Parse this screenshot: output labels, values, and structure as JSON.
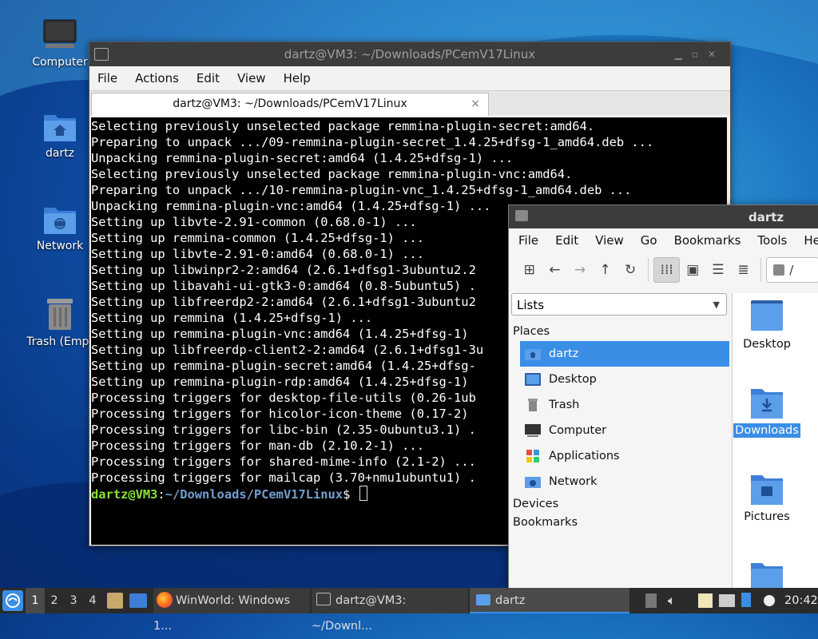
{
  "desktop": {
    "icons": [
      {
        "label": "Computer",
        "icon": "computer-icon"
      },
      {
        "label": "dartz",
        "icon": "home-folder-icon"
      },
      {
        "label": "Network",
        "icon": "network-folder-icon"
      },
      {
        "label": "Trash (Empt",
        "icon": "trash-icon"
      }
    ]
  },
  "terminal": {
    "window_title": "dartz@VM3: ~/Downloads/PCemV17Linux",
    "menu": [
      "File",
      "Actions",
      "Edit",
      "View",
      "Help"
    ],
    "tab_label": "dartz@VM3: ~/Downloads/PCemV17Linux",
    "tab_close": "×",
    "lines": [
      "Selecting previously unselected package remmina-plugin-secret:amd64.",
      "Preparing to unpack .../09-remmina-plugin-secret_1.4.25+dfsg-1_amd64.deb ...",
      "Unpacking remmina-plugin-secret:amd64 (1.4.25+dfsg-1) ...",
      "Selecting previously unselected package remmina-plugin-vnc:amd64.",
      "Preparing to unpack .../10-remmina-plugin-vnc_1.4.25+dfsg-1_amd64.deb ...",
      "Unpacking remmina-plugin-vnc:amd64 (1.4.25+dfsg-1) ...",
      "Setting up libvte-2.91-common (0.68.0-1) ...",
      "Setting up remmina-common (1.4.25+dfsg-1) ...",
      "Setting up libvte-2.91-0:amd64 (0.68.0-1) ...",
      "Setting up libwinpr2-2:amd64 (2.6.1+dfsg1-3ubuntu2.2",
      "Setting up libavahi-ui-gtk3-0:amd64 (0.8-5ubuntu5) .",
      "Setting up libfreerdp2-2:amd64 (2.6.1+dfsg1-3ubuntu2",
      "Setting up remmina (1.4.25+dfsg-1) ...",
      "Setting up remmina-plugin-vnc:amd64 (1.4.25+dfsg-1)",
      "Setting up libfreerdp-client2-2:amd64 (2.6.1+dfsg1-3u",
      "Setting up remmina-plugin-secret:amd64 (1.4.25+dfsg-",
      "Setting up remmina-plugin-rdp:amd64 (1.4.25+dfsg-1)",
      "Processing triggers for desktop-file-utils (0.26-1ub",
      "Processing triggers for hicolor-icon-theme (0.17-2)",
      "Processing triggers for libc-bin (2.35-0ubuntu3.1) .",
      "Processing triggers for man-db (2.10.2-1) ...",
      "Processing triggers for shared-mime-info (2.1-2) ...",
      "Processing triggers for mailcap (3.70+nmu1ubuntu1) ."
    ],
    "prompt_user": "dartz@VM3",
    "prompt_sep": ":",
    "prompt_path": "~/Downloads/PCemV17Linux",
    "prompt_end": "$ "
  },
  "filemanager": {
    "window_title": "dartz",
    "menu": [
      "File",
      "Edit",
      "View",
      "Go",
      "Bookmarks",
      "Tools",
      "Help"
    ],
    "path_text": "/",
    "side_combo": "Lists",
    "places_header": "Places",
    "places": [
      {
        "label": "dartz",
        "icon": "home-folder-icon",
        "selected": true
      },
      {
        "label": "Desktop",
        "icon": "desktop-folder-icon",
        "selected": false
      },
      {
        "label": "Trash",
        "icon": "trash-icon",
        "selected": false
      },
      {
        "label": "Computer",
        "icon": "computer-icon",
        "selected": false
      },
      {
        "label": "Applications",
        "icon": "applications-icon",
        "selected": false
      },
      {
        "label": "Network",
        "icon": "network-folder-icon",
        "selected": false
      }
    ],
    "devices_header": "Devices",
    "bookmarks_header": "Bookmarks",
    "items": [
      {
        "label": "Desktop",
        "icon": "desktop-folder-icon",
        "selected": false
      },
      {
        "label": "Downloads",
        "icon": "downloads-folder-icon",
        "selected": true
      },
      {
        "label": "Pictures",
        "icon": "pictures-folder-icon",
        "selected": false
      }
    ]
  },
  "taskbar": {
    "workspaces": [
      "1",
      "2",
      "3",
      "4"
    ],
    "active_workspace": "1",
    "tasks": [
      {
        "label": "WinWorld: Windows 1...",
        "icon": "firefox-icon"
      },
      {
        "label": "dartz@VM3: ~/Downl...",
        "icon": "terminal-icon"
      },
      {
        "label": "dartz",
        "icon": "folder-icon"
      }
    ],
    "clock": "20:42"
  },
  "colors": {
    "accent": "#3a8ee6",
    "prompt_user": "#8ae234",
    "prompt_path": "#729fcf"
  }
}
